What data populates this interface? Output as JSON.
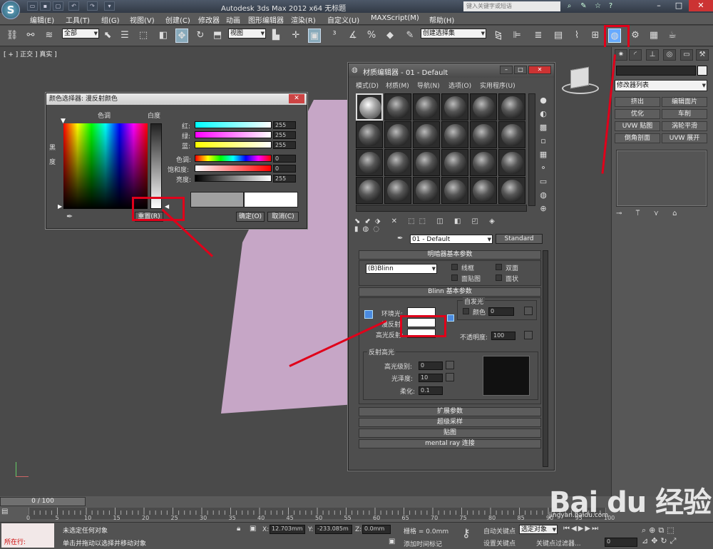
{
  "titlebar": {
    "title": "Autodesk 3ds Max  2012 x64      无标题",
    "search_placeholder": "键入关键字或短语",
    "quick_access": [
      "folder-open-icon",
      "save-icon",
      "undo-icon",
      "redo-icon",
      "dropdown-arrow-icon"
    ]
  },
  "menubar": {
    "items": [
      "编辑(E)",
      "工具(T)",
      "组(G)",
      "视图(V)",
      "创建(C)",
      "修改器",
      "动画",
      "图形编辑器",
      "渲染(R)",
      "自定义(U)",
      "MAXScript(M)",
      "帮助(H)"
    ]
  },
  "toolbar": {
    "selection_filter": "全部",
    "ref_coord": "视图",
    "named_sel": "创建选择集"
  },
  "viewport": {
    "label": "[ + ] 正交 ] 真实 ]"
  },
  "cmdpanel": {
    "modifier_list": "修改器列表",
    "buttons": [
      "挤出",
      "编辑面片",
      "优化",
      "车削",
      "UVW 贴图",
      "涡轮平滑",
      "倒角剖面",
      "UVW 展开"
    ]
  },
  "material_editor": {
    "title": "材质编辑器 - 01 - Default",
    "menu": [
      "模式(D)",
      "材质(M)",
      "导航(N)",
      "选项(O)",
      "实用程序(U)"
    ],
    "material_name": "01 - Default",
    "material_type": "Standard",
    "shader_rollout": "明暗器基本参数",
    "shader": "(B)Blinn",
    "wire": "线框",
    "two_sided": "双面",
    "face_map": "面贴图",
    "faceted": "面状",
    "blinn_rollout": "Blinn 基本参数",
    "self_illum": "自发光",
    "color_label": "颜色",
    "color_value": "0",
    "ambient": "环境光:",
    "diffuse": "漫反射:",
    "specular": "高光反射:",
    "opacity_label": "不透明度:",
    "opacity": "100",
    "spec_group": "反射高光",
    "spec_level_label": "高光级别:",
    "spec_level": "0",
    "gloss_label": "光泽度:",
    "gloss": "10",
    "soften_label": "柔化:",
    "soften": "0.1",
    "rollouts": [
      "扩展参数",
      "超级采样",
      "贴图",
      "mental ray 连接"
    ]
  },
  "color_picker": {
    "title": "颜色选择器: 漫反射颜色",
    "hue_label": "色调",
    "whiteness_label": "白度",
    "blackness_label": "黑\n\n度",
    "red_label": "红:",
    "green_label": "绿:",
    "blue_label": "蓝:",
    "hue_s_label": "色调:",
    "sat_label": "饱和度:",
    "val_label": "亮度:",
    "red": "255",
    "green": "255",
    "blue": "255",
    "hue": "0",
    "sat": "0",
    "val": "255",
    "reset": "重置(R)",
    "ok": "确定(O)",
    "cancel": "取消(C)"
  },
  "timeline": {
    "frame": "0 / 100",
    "ticks": [
      "0",
      "5",
      "10",
      "15",
      "20",
      "25",
      "30",
      "35",
      "40",
      "45",
      "50",
      "55",
      "60",
      "65",
      "70",
      "75",
      "80",
      "85",
      "90",
      "95",
      "100"
    ]
  },
  "status": {
    "script": "所在行:",
    "msg1": "未选定任何对象",
    "msg2": "单击并拖动以选择并移动对象",
    "x_label": "X:",
    "x": "12.703mm",
    "y_label": "Y:",
    "y": "-233.085m",
    "z_label": "Z:",
    "z": "0.0mm",
    "grid": "栅格 = 0.0mm",
    "add_time_tag": "添加时间标记",
    "auto_key": "自动关键点",
    "set_key": "设置关键点",
    "selected": "选定对象",
    "key_filters": "关键点过滤器...",
    "frame_field": "0"
  },
  "watermark": {
    "brand": "Bai du 经验",
    "url": "jingyan.baidu.com"
  },
  "colors": {
    "highlight": "#e0001a",
    "plane": "#c6a6c6"
  }
}
